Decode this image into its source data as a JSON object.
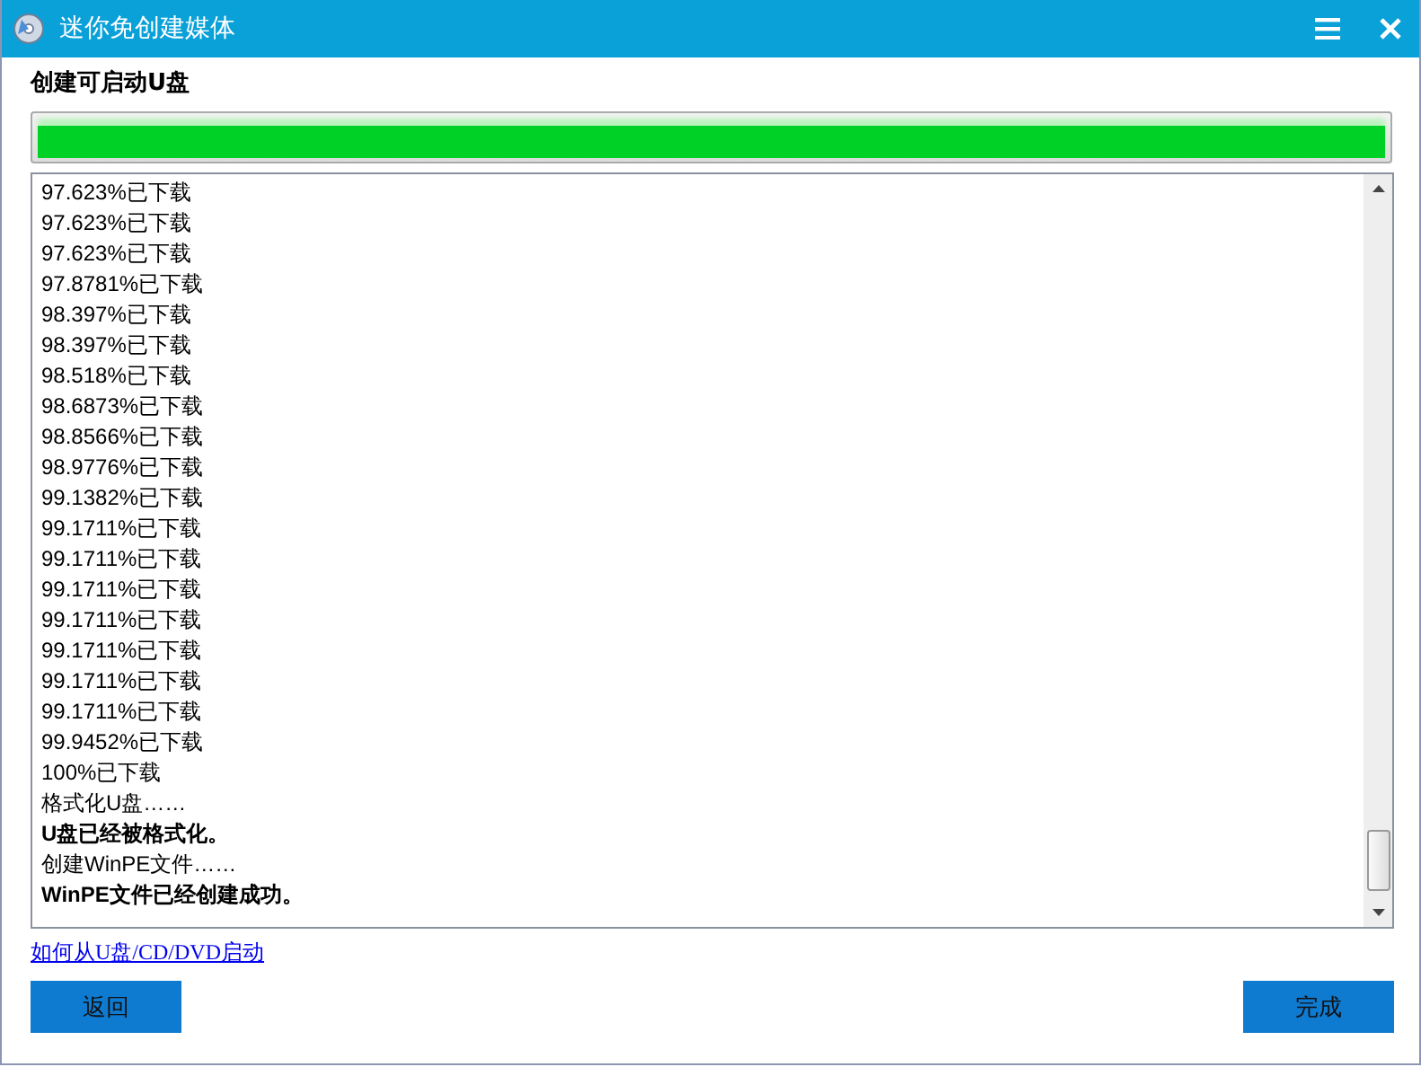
{
  "window": {
    "title": "迷你免创建媒体"
  },
  "heading": "创建可启动U盘",
  "progress": {
    "level": 1
  },
  "log": [
    {
      "text": "97.623%已下载",
      "kind": "normal"
    },
    {
      "text": "97.623%已下载",
      "kind": "normal"
    },
    {
      "text": "97.623%已下载",
      "kind": "normal"
    },
    {
      "text": "97.8781%已下载",
      "kind": "normal"
    },
    {
      "text": "98.397%已下载",
      "kind": "normal"
    },
    {
      "text": "98.397%已下载",
      "kind": "normal"
    },
    {
      "text": "98.518%已下载",
      "kind": "normal"
    },
    {
      "text": "98.6873%已下载",
      "kind": "normal"
    },
    {
      "text": "98.8566%已下载",
      "kind": "normal"
    },
    {
      "text": "98.9776%已下载",
      "kind": "normal"
    },
    {
      "text": "99.1382%已下载",
      "kind": "normal"
    },
    {
      "text": "99.1711%已下载",
      "kind": "normal"
    },
    {
      "text": "99.1711%已下载",
      "kind": "normal"
    },
    {
      "text": "99.1711%已下载",
      "kind": "normal"
    },
    {
      "text": "99.1711%已下载",
      "kind": "normal"
    },
    {
      "text": "99.1711%已下载",
      "kind": "normal"
    },
    {
      "text": "99.1711%已下载",
      "kind": "normal"
    },
    {
      "text": "99.1711%已下载",
      "kind": "normal"
    },
    {
      "text": "99.9452%已下载",
      "kind": "normal"
    },
    {
      "text": "100%已下载",
      "kind": "normal"
    },
    {
      "text": "格式化U盘……",
      "kind": "normal"
    },
    {
      "text": "U盘已经被格式化。",
      "kind": "bold"
    },
    {
      "text": "创建WinPE文件……",
      "kind": "normal"
    },
    {
      "text": "WinPE文件已经创建成功。",
      "kind": "bold"
    }
  ],
  "help_link": "如何从U盘/CD/DVD启动",
  "buttons": [
    {
      "label": "返回"
    },
    {
      "label": "完成"
    }
  ]
}
